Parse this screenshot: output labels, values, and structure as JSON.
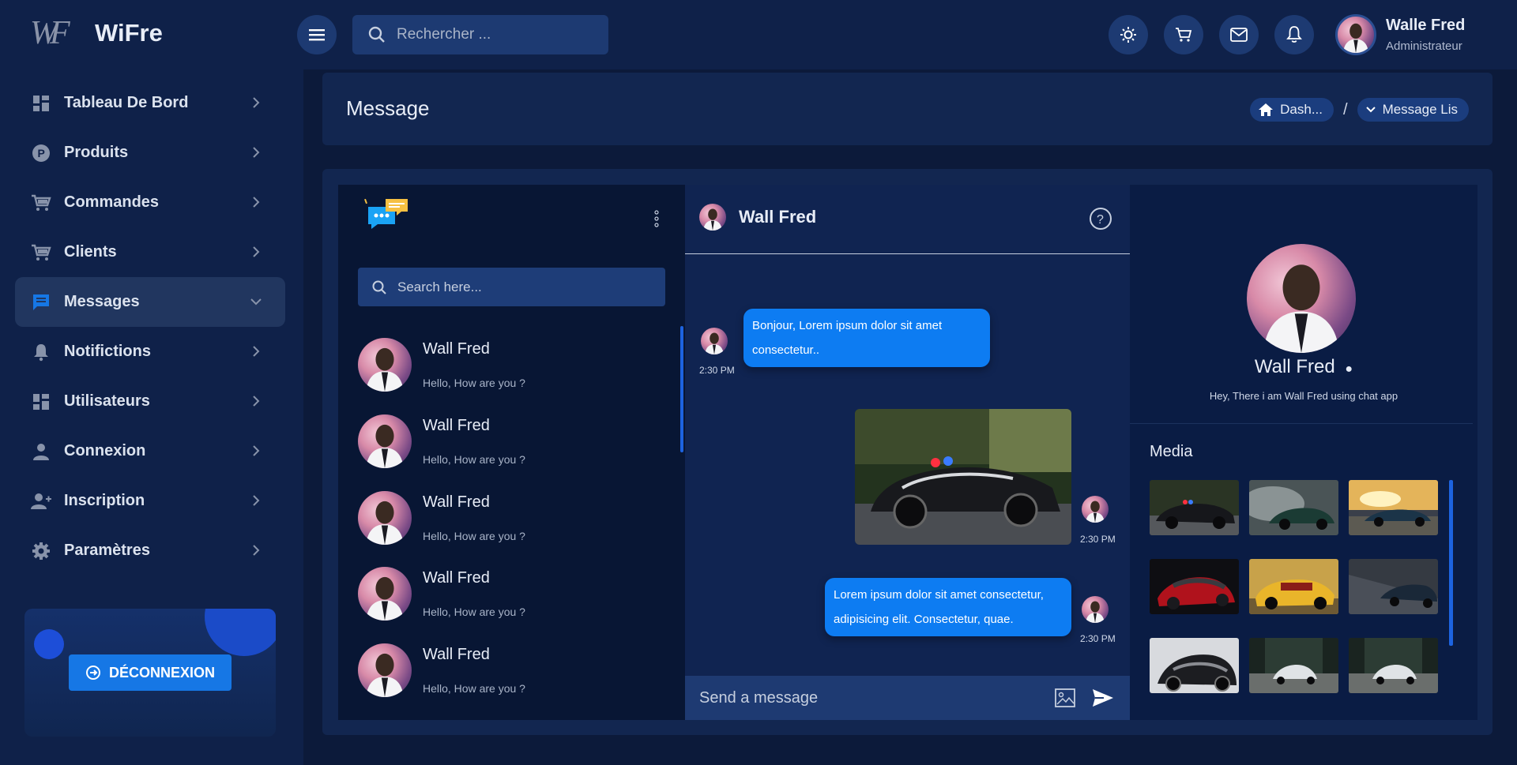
{
  "app": {
    "logo_text": "WiFre",
    "logo_mark": "WF"
  },
  "sidebar": {
    "items": [
      {
        "label": "Tableau De Bord",
        "icon": "dashboard-icon"
      },
      {
        "label": "Produits",
        "icon": "product-p-icon"
      },
      {
        "label": "Commandes",
        "icon": "cart-icon"
      },
      {
        "label": "Clients",
        "icon": "cart-icon"
      },
      {
        "label": "Messages",
        "icon": "message-icon",
        "active": true
      },
      {
        "label": "Notifictions",
        "icon": "bell-icon"
      },
      {
        "label": "Utilisateurs",
        "icon": "dashboard-icon"
      },
      {
        "label": "Connexion",
        "icon": "user-icon"
      },
      {
        "label": "Inscription",
        "icon": "user-add-icon"
      },
      {
        "label": "Paramètres",
        "icon": "gear-icon"
      }
    ],
    "logout_label": "DÉCONNEXION"
  },
  "topbar": {
    "search_placeholder": "Rechercher ...",
    "user_name": "Walle Fred",
    "user_role": "Administrateur"
  },
  "page": {
    "title": "Message",
    "breadcrumb": [
      "Dash...",
      "/",
      "Message Lis"
    ]
  },
  "chat_list": {
    "search_placeholder": "Search here...",
    "contacts": [
      {
        "name": "Wall Fred",
        "preview": "Hello, How are you ?"
      },
      {
        "name": "Wall Fred",
        "preview": "Hello, How are you ?"
      },
      {
        "name": "Wall Fred",
        "preview": "Hello, How are you ?"
      },
      {
        "name": "Wall Fred",
        "preview": "Hello, How are you ?"
      },
      {
        "name": "Wall Fred",
        "preview": "Hello, How are you ?"
      }
    ]
  },
  "chat": {
    "contact_name": "Wall Fred",
    "messages": [
      {
        "text": "Bonjour, Lorem ipsum dolor sit amet consectetur..",
        "time": "2:30 PM",
        "side": "left"
      },
      {
        "image": "police-car",
        "time": "2:30 PM",
        "side": "right"
      },
      {
        "text": "Lorem ipsum dolor sit amet consectetur, adipisicing elit. Consectetur, quae.",
        "time": "2:30 PM",
        "side": "right"
      }
    ],
    "composer_placeholder": "Send a message"
  },
  "profile": {
    "name": "Wall Fred",
    "status": "●",
    "bio": "Hey, There i am Wall Fred using chat app",
    "media_title": "Media",
    "media": [
      "police-car",
      "smoke-car",
      "sunset-car",
      "red-car",
      "yellow-car",
      "dark-car",
      "racing-car",
      "rally-car",
      "rally-car-2"
    ]
  },
  "colors": {
    "accent": "#0d7cf2",
    "sidebar_bg": "#0f2149",
    "page_bg": "#0c1a3a",
    "card_bg": "#122650"
  }
}
